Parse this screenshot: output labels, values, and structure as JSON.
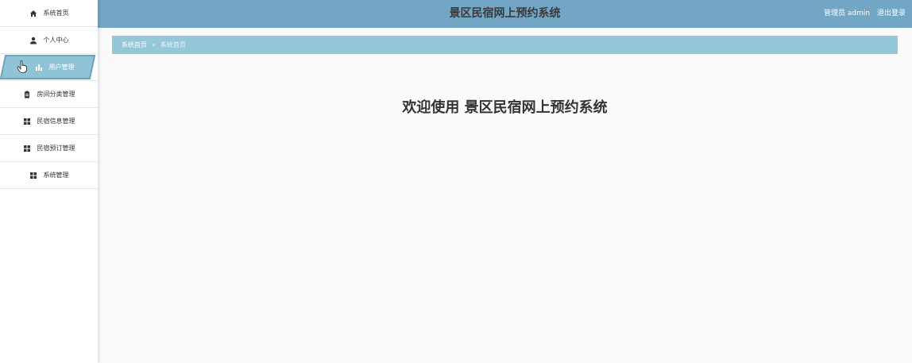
{
  "sidebar": {
    "items": [
      {
        "label": "系统首页",
        "icon": "home-icon"
      },
      {
        "label": "个人中心",
        "icon": "user-icon"
      },
      {
        "label": "用户管理",
        "icon": "bar-chart-icon",
        "active": true
      },
      {
        "label": "房间分类管理",
        "icon": "clipboard-icon"
      },
      {
        "label": "民宿信息管理",
        "icon": "grid-icon"
      },
      {
        "label": "民宿预订管理",
        "icon": "grid-icon"
      },
      {
        "label": "系统管理",
        "icon": "grid-icon"
      }
    ]
  },
  "header": {
    "title": "景区民宿网上预约系统",
    "user_label": "管理员 admin",
    "logout_label": "退出登录"
  },
  "breadcrumb": {
    "home": "系统首页",
    "separator": "»",
    "current": "系统首页"
  },
  "main": {
    "welcome": "欢迎使用 景区民宿网上预约系统"
  },
  "colors": {
    "header_bg": "#73a6c5",
    "breadcrumb_bg": "#94c7d8",
    "active_menu_bg": "#8fc4d6"
  }
}
